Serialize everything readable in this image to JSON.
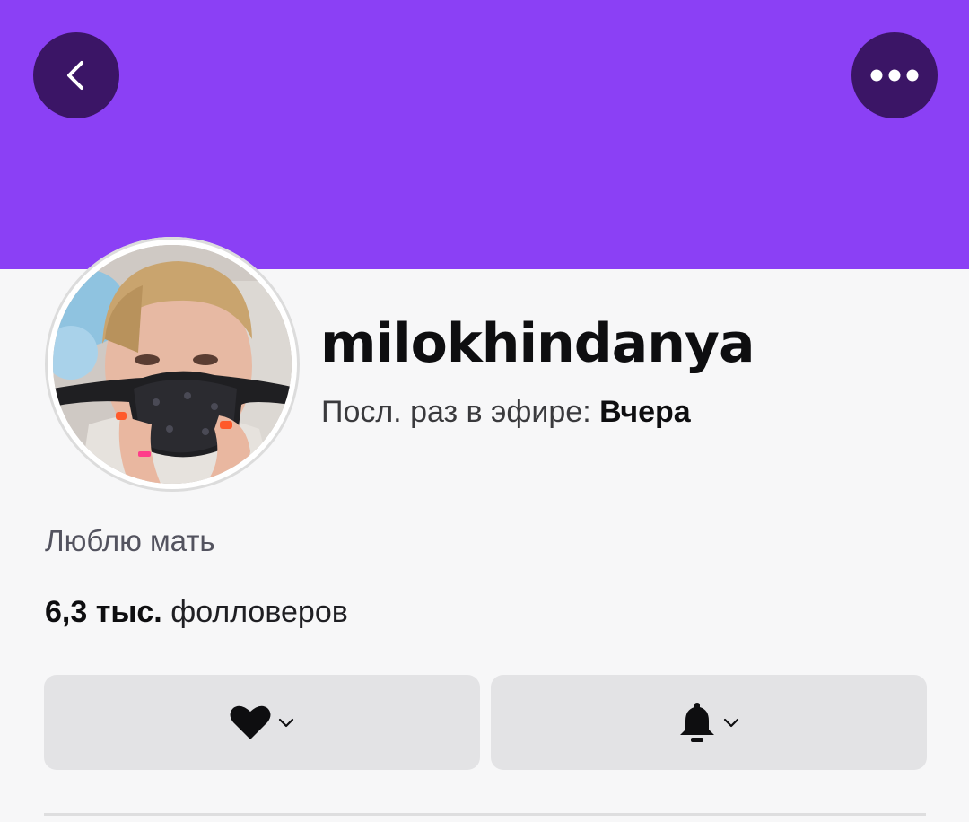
{
  "profile": {
    "username": "milokhindanya",
    "last_live_label": "Посл. раз в эфире:",
    "last_live_value": "Вчера",
    "bio": "Люблю мать",
    "followers_count": "6,3 тыс.",
    "followers_label": "фолловеров"
  },
  "icons": {
    "back": "chevron-left-icon",
    "more": "more-dots-icon",
    "follow": "heart-icon",
    "notify": "bell-icon",
    "dropdown": "chevron-down-icon"
  },
  "colors": {
    "banner": "#8b40f5",
    "round_button": "#3b1566",
    "action_button": "#e3e3e5"
  }
}
